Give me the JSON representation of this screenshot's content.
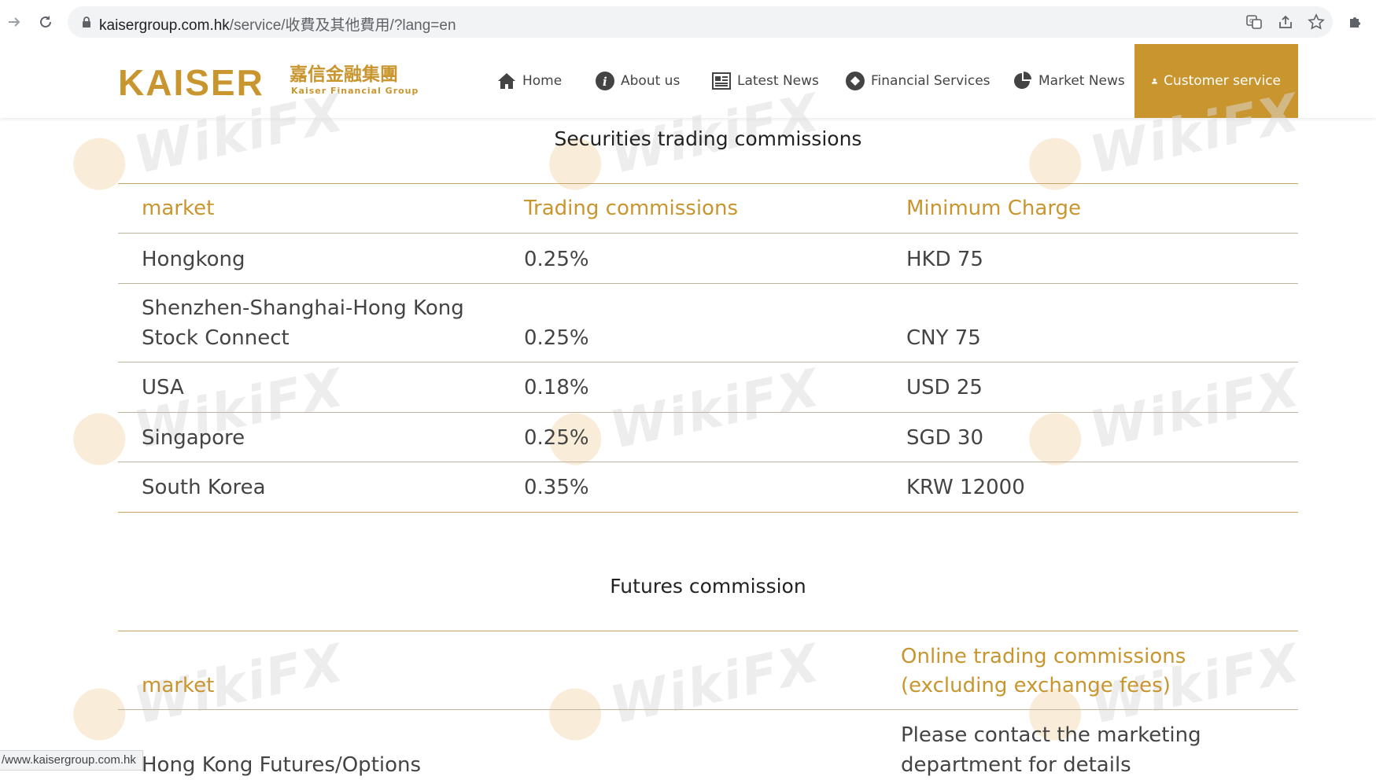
{
  "browser": {
    "url_host": "kaisergroup.com.hk",
    "url_path": "/service/收費及其他費用/?lang=en",
    "status_url": "/www.kaisergroup.com.hk"
  },
  "header": {
    "logo_text": "KAISER",
    "logo_cn": "嘉信金融集團",
    "logo_en": "Kaiser Financial Group",
    "nav": [
      {
        "label": "Home",
        "icon": "home-icon"
      },
      {
        "label": "About us",
        "icon": "info-icon"
      },
      {
        "label": "Latest News",
        "icon": "newspaper-icon"
      },
      {
        "label": "Financial Services",
        "icon": "diamond-icon"
      },
      {
        "label": "Market News",
        "icon": "pie-chart-icon"
      },
      {
        "label": "Customer service",
        "icon": "user-icon",
        "active": true
      }
    ]
  },
  "watermark": "WikiFX",
  "securities": {
    "title": "Securities trading commissions",
    "headers": [
      "market",
      "Trading commissions",
      "Minimum Charge"
    ],
    "rows": [
      {
        "market": "Hongkong",
        "commission": "0.25%",
        "min": "HKD 75"
      },
      {
        "market_line1": "Shenzhen-Shanghai-Hong Kong",
        "market_line2": "Stock Connect",
        "commission": "0.25%",
        "min": "CNY 75"
      },
      {
        "market": "USA",
        "commission": "0.18%",
        "min": "USD 25"
      },
      {
        "market": "Singapore",
        "commission": "0.25%",
        "min": "SGD 30"
      },
      {
        "market": "South Korea",
        "commission": "0.35%",
        "min": "KRW 12000"
      }
    ]
  },
  "futures": {
    "title": "Futures commission",
    "headers": [
      "market",
      "Online trading commissions",
      "(excluding exchange fees)"
    ],
    "rows": [
      {
        "market": "Hong Kong Futures/Options",
        "commission_line1": "Please contact the marketing",
        "commission_line2": "department for details"
      }
    ]
  },
  "colors": {
    "accent": "#c9952e",
    "text": "#444444",
    "rule": "#c9a265"
  }
}
